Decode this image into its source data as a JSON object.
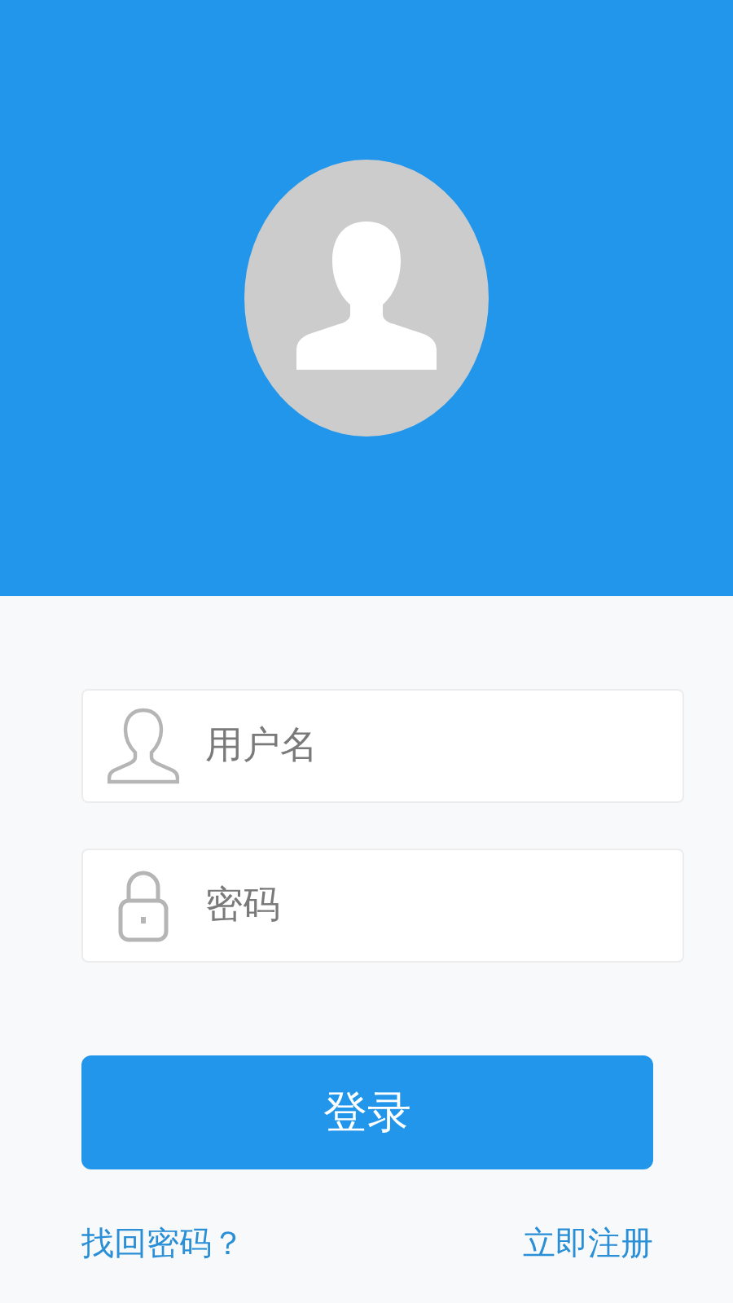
{
  "fields": [
    {
      "kind": "user",
      "placeholder": "用户名"
    },
    {
      "kind": "lock",
      "placeholder": "密码"
    }
  ],
  "login_button": "登录",
  "links": {
    "forgot": "找回密码？",
    "register": "立即注册"
  }
}
